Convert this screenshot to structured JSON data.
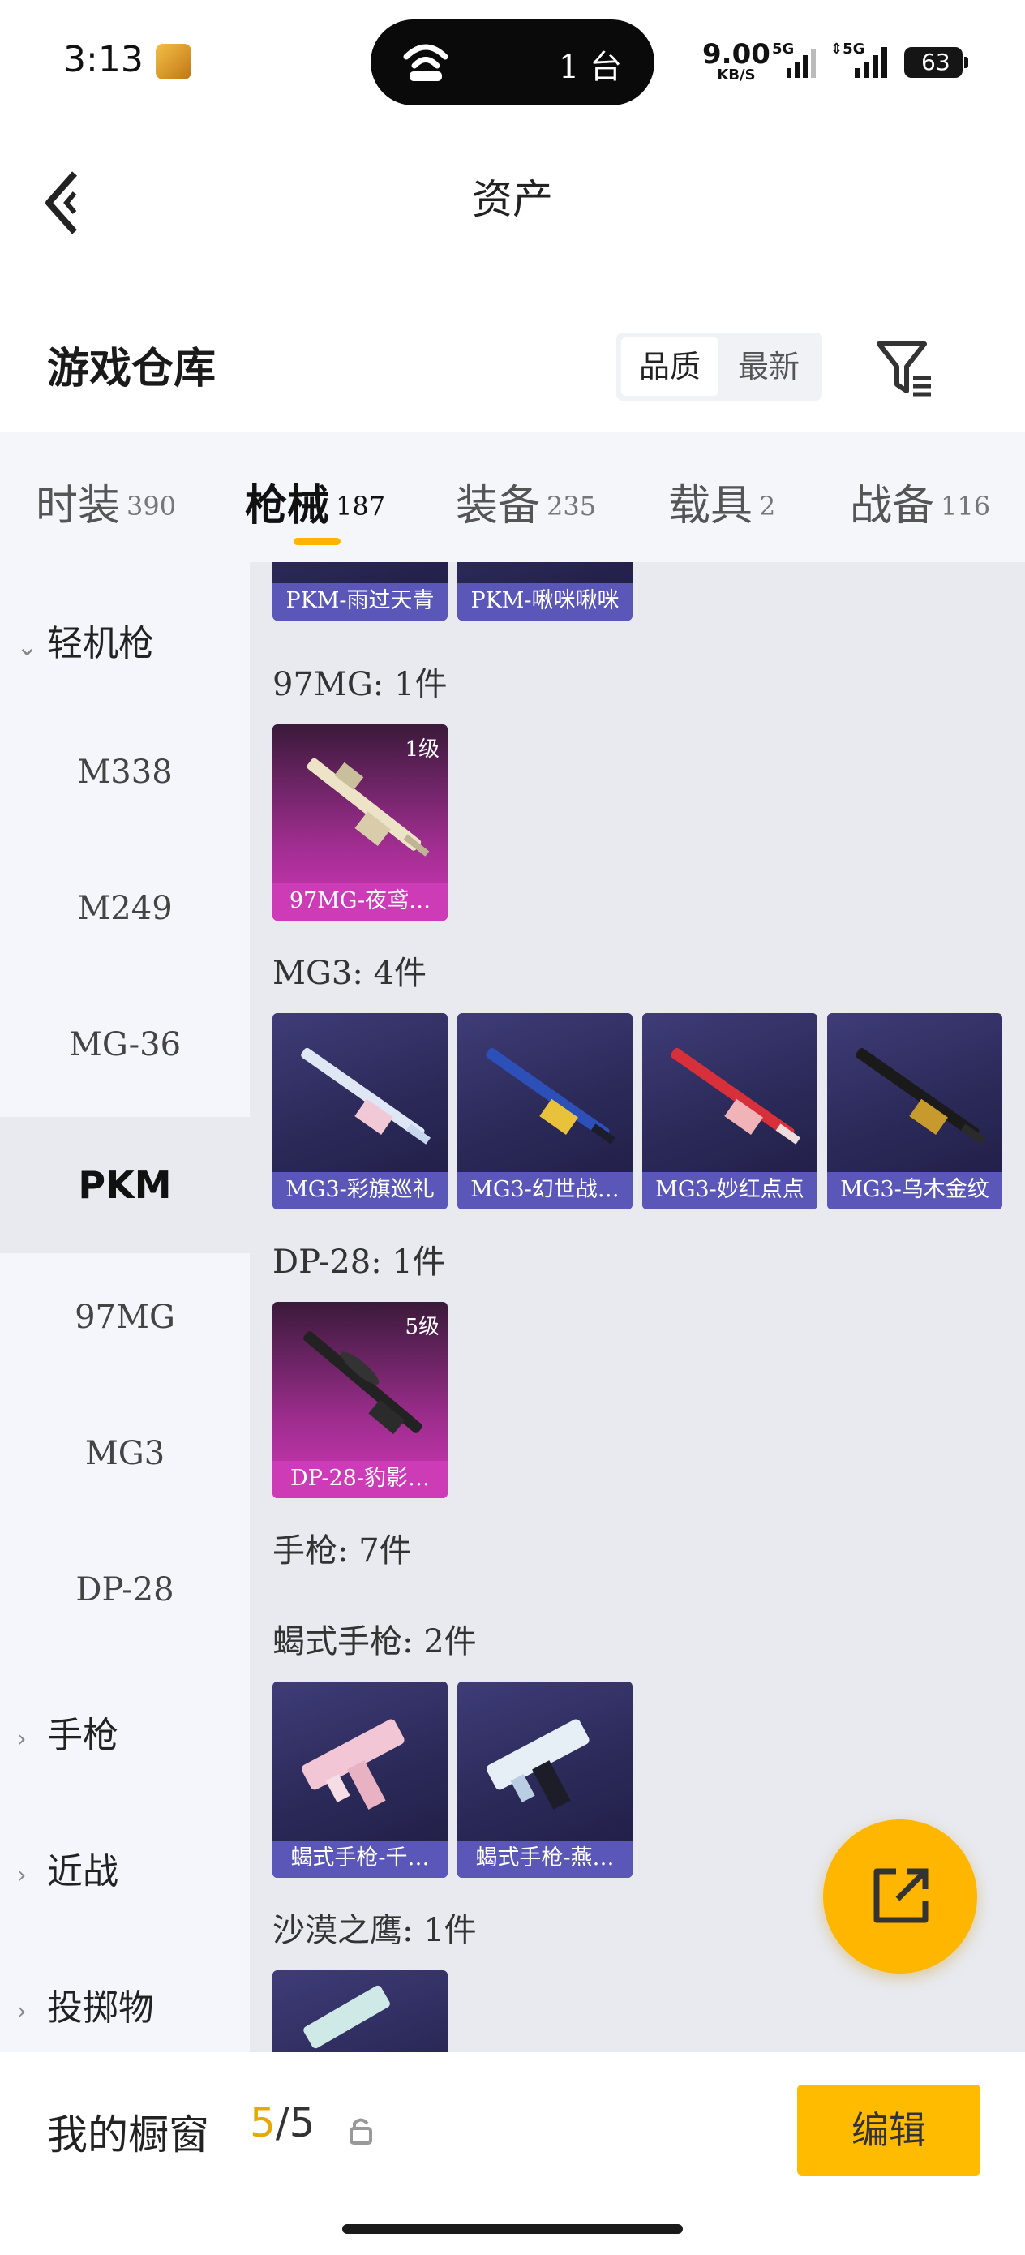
{
  "status_bar": {
    "time": "3:13",
    "pill_count": "1 台",
    "net_speed": "9.00",
    "net_unit": "KB/S",
    "sim1": "5G",
    "sim2": "5G",
    "battery": "63"
  },
  "header": {
    "title": "资产"
  },
  "section": {
    "title": "游戏仓库",
    "sort_options": [
      "品质",
      "最新"
    ],
    "active_sort": "品质"
  },
  "tabs": [
    {
      "label": "时装",
      "count": "390"
    },
    {
      "label": "枪械",
      "count": "187"
    },
    {
      "label": "装备",
      "count": "235"
    },
    {
      "label": "载具",
      "count": "2"
    },
    {
      "label": "战备",
      "count": "116"
    }
  ],
  "active_tab": "枪械",
  "sidebar": {
    "expanded_category": "轻机枪",
    "subitems": [
      "M338",
      "M249",
      "MG-36",
      "PKM",
      "97MG",
      "MG3",
      "DP-28"
    ],
    "selected": "PKM",
    "collapsed_categories": [
      "手枪",
      "近战",
      "投掷物"
    ]
  },
  "content": {
    "pkm_cards": [
      "PKM-雨过天青",
      "PKM-啾咪啾咪"
    ],
    "groups": [
      {
        "label": "97MG: 1件",
        "cards": [
          {
            "name": "97MG-夜鸢…",
            "level": "1级",
            "rarity": "gold"
          }
        ]
      },
      {
        "label": "MG3: 4件",
        "cards": [
          {
            "name": "MG3-彩旗巡礼",
            "rarity": "purple"
          },
          {
            "name": "MG3-幻世战…",
            "rarity": "purple"
          },
          {
            "name": "MG3-妙红点点",
            "rarity": "purple"
          },
          {
            "name": "MG3-乌木金纹",
            "rarity": "purple"
          }
        ]
      },
      {
        "label": "DP-28: 1件",
        "cards": [
          {
            "name": "DP-28-豹影…",
            "level": "5级",
            "rarity": "gold"
          }
        ]
      }
    ],
    "pistol_header": "手枪: 7件",
    "scorpion": {
      "label": "蝎式手枪: 2件",
      "cards": [
        "蝎式手枪-千…",
        "蝎式手枪-燕…"
      ]
    },
    "deagle": {
      "label": "沙漠之鹰: 1件"
    }
  },
  "showcase": {
    "title": "我的橱窗",
    "current": "5",
    "total": "/5",
    "edit_label": "编辑"
  },
  "colors": {
    "accent": "#ffb600",
    "purple_card": "#5b57b8",
    "gold_card": "#cd3bb7"
  }
}
